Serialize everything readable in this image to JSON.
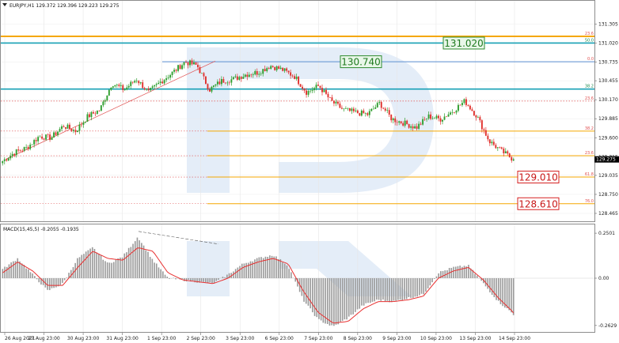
{
  "header": {
    "symbol_line": "EURJPY,H1  129.372 129.396 129.223 129.275",
    "indicator_line": "MACD(15,45,5) -0.2055 -0.1935"
  },
  "colors": {
    "bull": "#2e9e2e",
    "bear": "#e0302c",
    "level_orange": "#f5a700",
    "level_teal": "#16a0b5",
    "level_blue": "#5b8fd3",
    "level_red_dot": "#e05050",
    "macd_hist": "#9a9a9a",
    "macd_signal": "#e83030",
    "price_tag_bg": "#000000"
  },
  "chart_data": [
    {
      "type": "candlestick",
      "title": "EURJPY,H1",
      "timeframe": "H1",
      "ohlc_last": {
        "open": 129.372,
        "high": 129.396,
        "low": 129.223,
        "close": 129.275
      },
      "current_price_tag": "129.275",
      "ylim": [
        128.37,
        131.5
      ],
      "y_ticks": [
        "131.305",
        "131.020",
        "130.735",
        "130.455",
        "130.170",
        "129.885",
        "129.600",
        "129.315",
        "129.035",
        "128.750",
        "128.465"
      ],
      "x_ticks": [
        "26 Aug 2021",
        "27 Aug 23:00",
        "30 Aug 23:00",
        "31 Aug 23:00",
        "1 Sep 23:00",
        "2 Sep 23:00",
        "3 Sep 23:00",
        "6 Sep 23:00",
        "7 Sep 23:00",
        "8 Sep 23:00",
        "9 Sep 23:00",
        "10 Sep 23:00",
        "13 Sep 23:00",
        "14 Sep 23:00"
      ],
      "anchor_closes": [
        129.25,
        129.38,
        129.45,
        129.62,
        129.6,
        129.78,
        129.7,
        129.92,
        130.02,
        130.42,
        130.32,
        130.48,
        130.28,
        130.44,
        130.58,
        130.74,
        130.68,
        130.32,
        130.45,
        130.48,
        130.55,
        130.58,
        130.68,
        130.62,
        130.52,
        130.28,
        130.38,
        130.15,
        130.02,
        129.98,
        129.95,
        130.12,
        129.88,
        129.82,
        129.75,
        129.92,
        129.88,
        130.0,
        130.15,
        129.92,
        129.55,
        129.4,
        129.275
      ],
      "levels": [
        {
          "label": "23.6",
          "price": 131.12,
          "style": "orange-thick"
        },
        {
          "label": "50.0",
          "price": 131.02,
          "style": "teal-thick"
        },
        {
          "label": "0.0",
          "price": 130.74,
          "style": "blue-thin"
        },
        {
          "label": "38.2",
          "price": 130.33,
          "style": "teal-thick"
        },
        {
          "label": "23.6",
          "price": 130.15,
          "style": "red-dotted"
        },
        {
          "label": "38.2",
          "price": 129.7,
          "style": "orange-thin"
        },
        {
          "label": "23.6",
          "price": 129.33,
          "style": "orange-thin"
        },
        {
          "label": "61.8",
          "price": 129.01,
          "style": "orange-thin"
        },
        {
          "label": "76.0",
          "price": 128.61,
          "style": "orange-thin"
        }
      ],
      "callouts": [
        {
          "text": "131.020",
          "price": 131.02,
          "color": "green"
        },
        {
          "text": "130.740",
          "price": 130.74,
          "color": "green"
        },
        {
          "text": "129.010",
          "price": 129.01,
          "color": "red"
        },
        {
          "text": "128.610",
          "price": 128.61,
          "color": "red"
        }
      ]
    },
    {
      "type": "histogram",
      "indicator": "MACD(15,45,5)",
      "values_last": [
        -0.2055,
        -0.1935
      ],
      "ylim": [
        -0.29,
        0.29
      ],
      "y_ticks": [
        "0.2501",
        "0.00",
        "-0.2629"
      ],
      "anchor_hist": [
        0.05,
        0.11,
        0.02,
        -0.07,
        -0.03,
        0.11,
        0.17,
        0.08,
        0.12,
        0.23,
        0.1,
        0.0,
        -0.01,
        -0.02,
        -0.03,
        0.02,
        0.08,
        0.11,
        0.13,
        0.07,
        -0.12,
        -0.23,
        -0.27,
        -0.22,
        -0.15,
        -0.12,
        -0.13,
        -0.11,
        -0.09,
        0.03,
        0.06,
        0.07,
        -0.03,
        -0.13,
        -0.2
      ],
      "anchor_signal": [
        0.03,
        0.09,
        0.04,
        -0.04,
        -0.04,
        0.06,
        0.15,
        0.11,
        0.1,
        0.17,
        0.15,
        0.03,
        -0.01,
        -0.02,
        -0.03,
        0.0,
        0.06,
        0.09,
        0.11,
        0.08,
        -0.07,
        -0.19,
        -0.25,
        -0.24,
        -0.17,
        -0.13,
        -0.13,
        -0.12,
        -0.1,
        0.0,
        0.04,
        0.06,
        -0.01,
        -0.11,
        -0.19
      ]
    }
  ]
}
